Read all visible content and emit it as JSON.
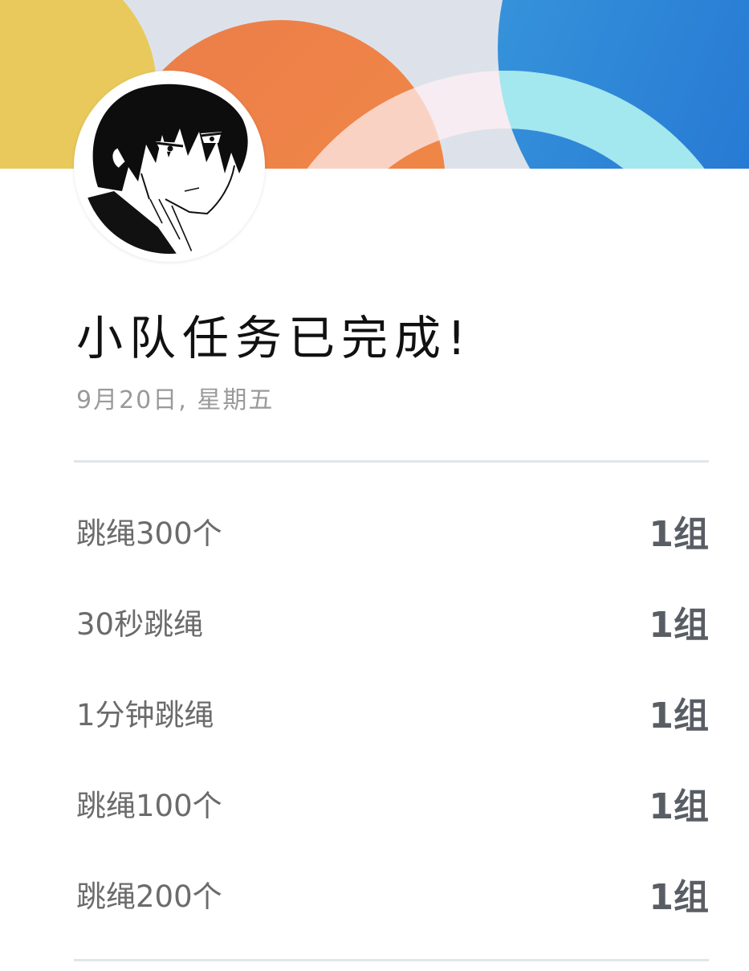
{
  "colors": {
    "title": "#111111",
    "date": "#9a9a9a",
    "task_name": "#6b6b6b",
    "task_sets": "#595e65",
    "divider": "#e2e5e8",
    "banner_background": "#dde2ea",
    "banner_yellow": "#e9c95b",
    "banner_orange": "#ee7c45",
    "banner_blue": "#2a86d8",
    "banner_cyan": "#a3e7ef"
  },
  "avatar": {
    "icon": "anime-character-portrait-icon"
  },
  "title": "小队任务已完成!",
  "date": "9月20日, 星期五",
  "tasks": [
    {
      "name": "跳绳300个",
      "sets": "1组"
    },
    {
      "name": "30秒跳绳",
      "sets": "1组"
    },
    {
      "name": "1分钟跳绳",
      "sets": "1组"
    },
    {
      "name": "跳绳100个",
      "sets": "1组"
    },
    {
      "name": "跳绳200个",
      "sets": "1组"
    }
  ]
}
